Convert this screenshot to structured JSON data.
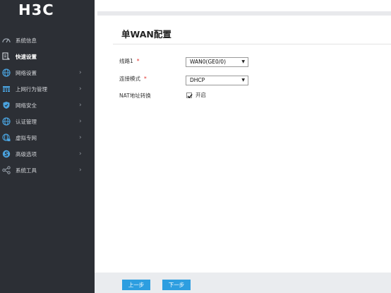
{
  "brand": {
    "logo_text": "H3C"
  },
  "sidebar": {
    "items": [
      {
        "label": "系统信息",
        "icon": "gauge-icon",
        "has_submenu": false
      },
      {
        "label": "快速设置",
        "icon": "quick-setup-icon",
        "has_submenu": false,
        "active": true
      },
      {
        "label": "网络设置",
        "icon": "globe-icon",
        "has_submenu": true
      },
      {
        "label": "上网行为管理",
        "icon": "table-icon",
        "has_submenu": true
      },
      {
        "label": "网络安全",
        "icon": "shield-icon",
        "has_submenu": true
      },
      {
        "label": "认证管理",
        "icon": "globe-icon",
        "has_submenu": true
      },
      {
        "label": "虚拟专网",
        "icon": "vpn-globe-icon",
        "has_submenu": true
      },
      {
        "label": "高级选项",
        "icon": "advanced-icon",
        "has_submenu": true
      },
      {
        "label": "系统工具",
        "icon": "share-icon",
        "has_submenu": true
      }
    ],
    "chevron": "›"
  },
  "page": {
    "title": "单WAN配置"
  },
  "form": {
    "line_label": "线路1",
    "line_value": "WAN0(GE0/0)",
    "mode_label": "连接模式",
    "mode_value": "DHCP",
    "nat_label": "NAT地址转换",
    "nat_checked": true,
    "nat_option_label": "开启",
    "required_mark": "*"
  },
  "footer": {
    "prev_label": "上一步",
    "next_label": "下一步"
  },
  "colors": {
    "sidebar_bg": "#2c2f35",
    "accent": "#2d9ee0",
    "required": "#e0302b"
  }
}
